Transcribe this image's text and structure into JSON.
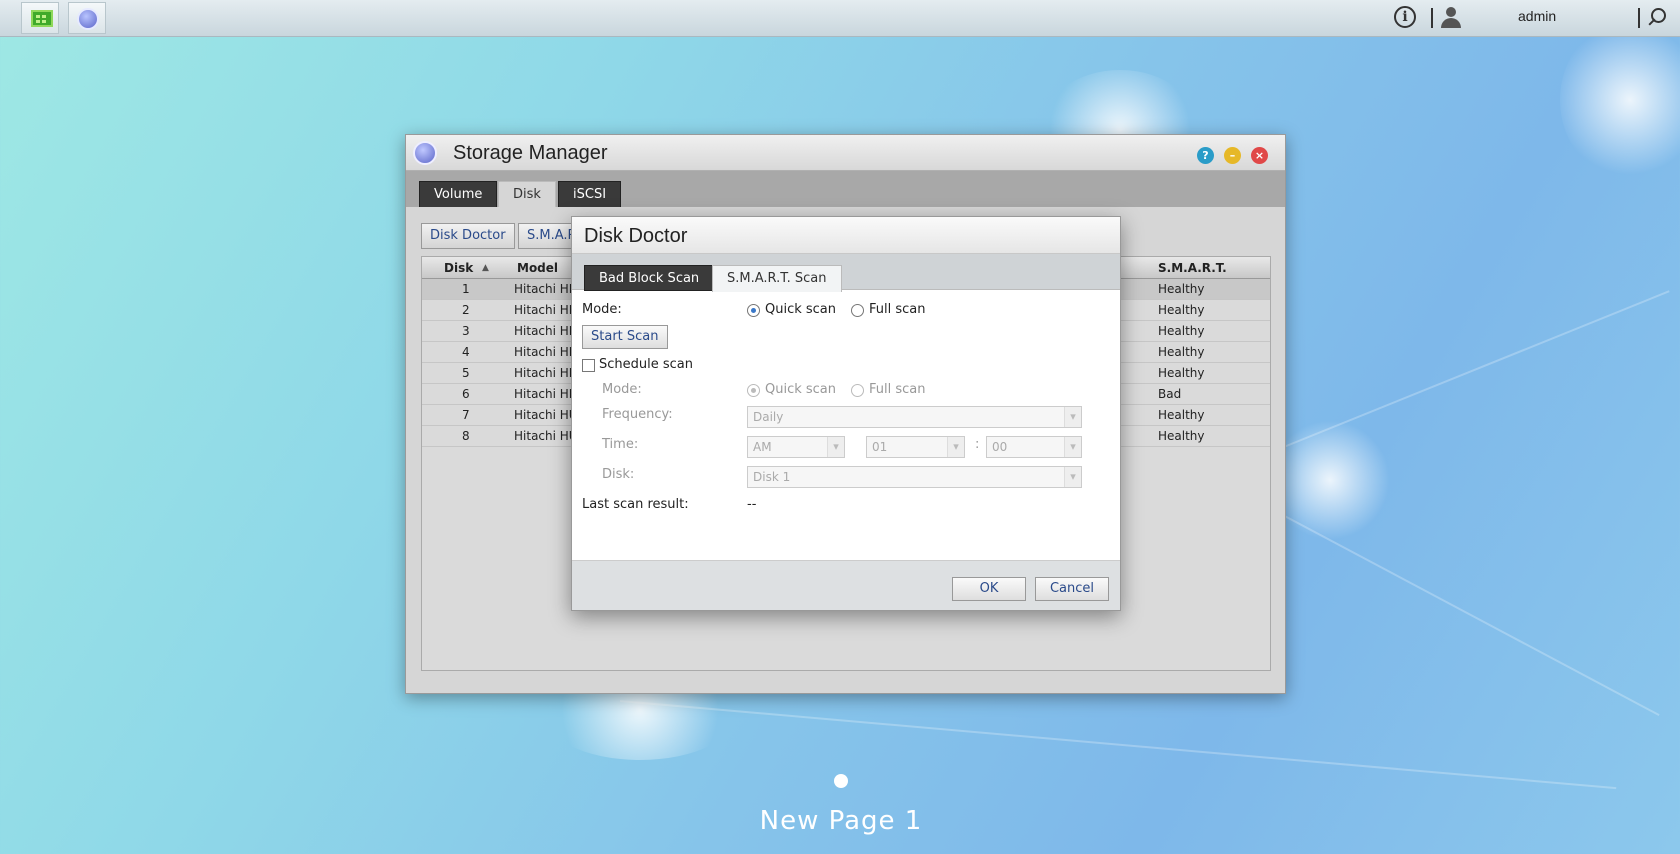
{
  "taskbar": {
    "apps": [
      {
        "name": "control-panel-icon"
      },
      {
        "name": "storage-manager-icon"
      }
    ],
    "user": "admin"
  },
  "window": {
    "title": "Storage Manager",
    "tabs": [
      "Volume",
      "Disk",
      "iSCSI"
    ],
    "active_tab": "Disk",
    "toolbar": [
      "Disk Doctor",
      "S.M.A.R."
    ],
    "columns": {
      "disk": "Disk",
      "model": "Model",
      "smart": "S.M.A.R.T."
    },
    "sort": "ascending",
    "rows": [
      {
        "disk": "1",
        "model": "Hitachi HD",
        "smart": "Healthy"
      },
      {
        "disk": "2",
        "model": "Hitachi HD",
        "smart": "Healthy"
      },
      {
        "disk": "3",
        "model": "Hitachi HD",
        "smart": "Healthy"
      },
      {
        "disk": "4",
        "model": "Hitachi HD",
        "smart": "Healthy"
      },
      {
        "disk": "5",
        "model": "Hitachi HD",
        "smart": "Healthy"
      },
      {
        "disk": "6",
        "model": "Hitachi HD",
        "smart": "Bad"
      },
      {
        "disk": "7",
        "model": "Hitachi HU",
        "smart": "Healthy"
      },
      {
        "disk": "8",
        "model": "Hitachi HU",
        "smart": "Healthy"
      }
    ]
  },
  "dialog": {
    "title": "Disk Doctor",
    "tabs": [
      "Bad Block Scan",
      "S.M.A.R.T. Scan"
    ],
    "active_tab": "S.M.A.R.T. Scan",
    "mode_label": "Mode:",
    "mode_options": [
      "Quick scan",
      "Full scan"
    ],
    "mode_selected": "Quick scan",
    "start_scan": "Start Scan",
    "schedule_label": "Schedule scan",
    "schedule_checked": false,
    "schedule": {
      "mode_label": "Mode:",
      "mode_options": [
        "Quick scan",
        "Full scan"
      ],
      "frequency_label": "Frequency:",
      "frequency": "Daily",
      "time_label": "Time:",
      "ampm": "AM",
      "hour": "01",
      "time_sep": ":",
      "minute": "00",
      "disk_label": "Disk:",
      "disk": "Disk 1"
    },
    "last_result_label": "Last scan result:",
    "last_result": "--",
    "ok": "OK",
    "cancel": "Cancel"
  },
  "desktop": {
    "page_name": "New Page 1"
  },
  "colors": {
    "accent": "#2a4a8a",
    "tab_dark": "#3a3a3a",
    "radio_selected": "#3a78c8"
  }
}
